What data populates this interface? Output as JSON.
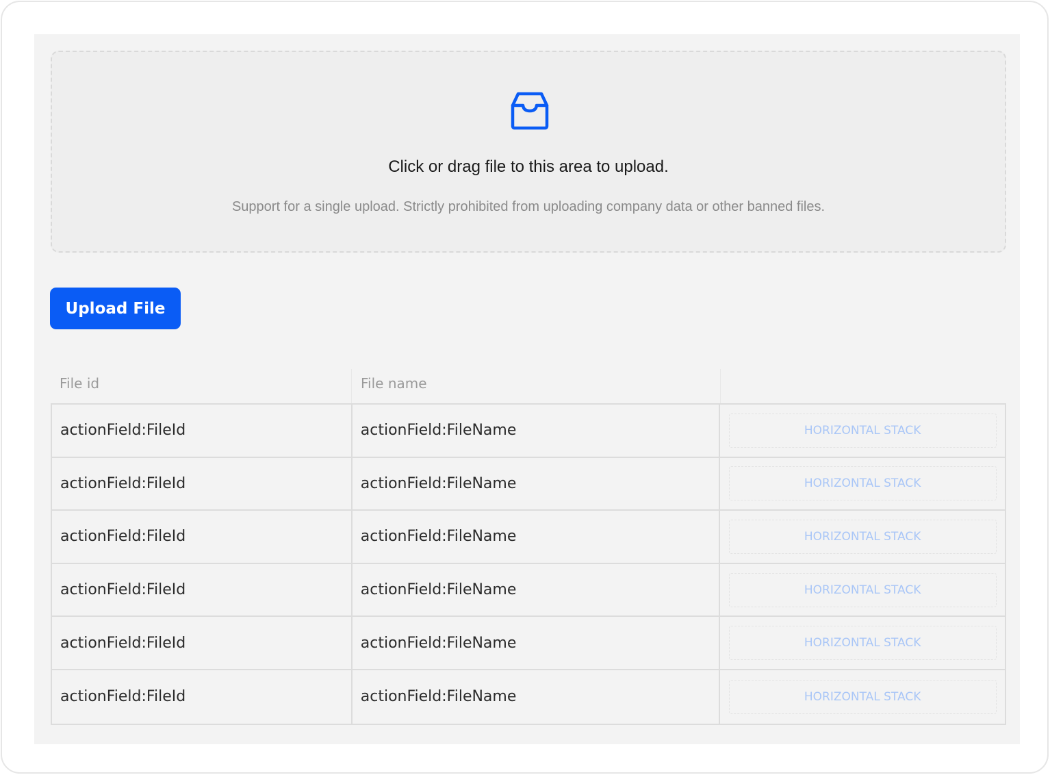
{
  "dropzone": {
    "icon": "inbox-icon",
    "title": "Click or drag file to this area to upload.",
    "hint": "Support for a single upload. Strictly prohibited from uploading company data or other banned files."
  },
  "upload_button": {
    "label": "Upload File"
  },
  "table": {
    "columns": [
      "File id",
      "File name",
      ""
    ],
    "rows": [
      {
        "file_id": "actionField:FileId",
        "file_name": "actionField:FileName",
        "action": "HORIZONTAL STACK"
      },
      {
        "file_id": "actionField:FileId",
        "file_name": "actionField:FileName",
        "action": "HORIZONTAL STACK"
      },
      {
        "file_id": "actionField:FileId",
        "file_name": "actionField:FileName",
        "action": "HORIZONTAL STACK"
      },
      {
        "file_id": "actionField:FileId",
        "file_name": "actionField:FileName",
        "action": "HORIZONTAL STACK"
      },
      {
        "file_id": "actionField:FileId",
        "file_name": "actionField:FileName",
        "action": "HORIZONTAL STACK"
      },
      {
        "file_id": "actionField:FileId",
        "file_name": "actionField:FileName",
        "action": "HORIZONTAL STACK"
      }
    ]
  },
  "colors": {
    "primary": "#0a5cf5",
    "placeholder_text": "#a9c6f7"
  }
}
